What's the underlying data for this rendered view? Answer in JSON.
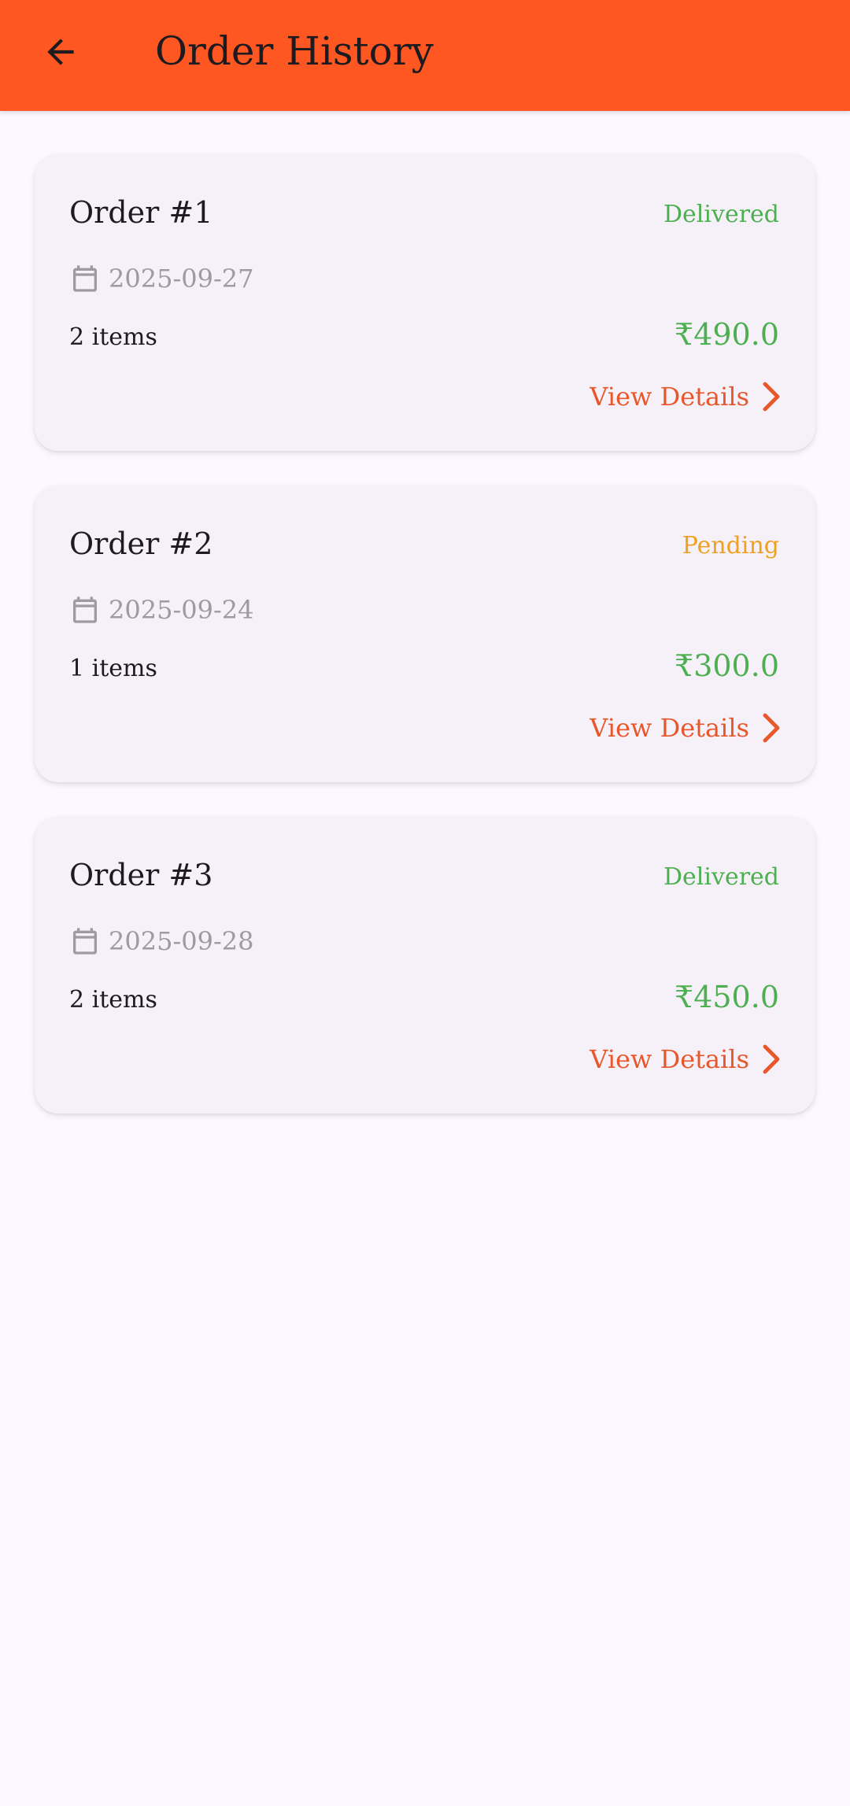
{
  "header": {
    "title": "Order History",
    "back_icon": "arrow-back-icon"
  },
  "colors": {
    "app_bar": "#FF5722",
    "delivered": "#4CAF50",
    "pending": "#F0A020",
    "price": "#4CAF50",
    "accent": "#E8572A",
    "muted": "#9E9AA2"
  },
  "orders": [
    {
      "title": "Order #1",
      "status": "Delivered",
      "date": "2025-09-27",
      "items": "2 items",
      "price": "₹490.0",
      "action": "View Details"
    },
    {
      "title": "Order #2",
      "status": "Pending",
      "date": "2025-09-24",
      "items": "1 items",
      "price": "₹300.0",
      "action": "View Details"
    },
    {
      "title": "Order #3",
      "status": "Delivered",
      "date": "2025-09-28",
      "items": "2 items",
      "price": "₹450.0",
      "action": "View Details"
    }
  ]
}
